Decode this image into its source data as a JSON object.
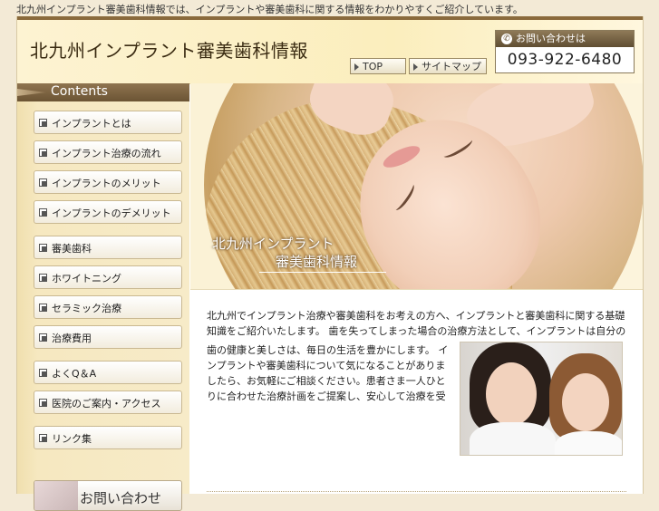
{
  "top_text": "北九州インプラント審美歯科情報では、インプラントや審美歯科に関する情報をわかりやすくご紹介しています。",
  "header": {
    "site_title": "北九州インプラント審美歯科情報",
    "nav": [
      {
        "label": "TOP",
        "icon": "arrow-right-icon"
      },
      {
        "label": "サイトマップ",
        "icon": "arrow-right-icon"
      }
    ],
    "contact_label": "お問い合わせは",
    "phone": "093-922-6480"
  },
  "sidebar": {
    "title": "Contents",
    "items": [
      {
        "label": "インプラントとは"
      },
      {
        "label": "インプラント治療の流れ"
      },
      {
        "label": "インプラントのメリット"
      },
      {
        "label": "インプラントのデメリット"
      },
      {
        "label": "審美歯科"
      },
      {
        "label": "ホワイトニング"
      },
      {
        "label": "セラミック治療"
      },
      {
        "label": "治療費用"
      },
      {
        "label": "よくQ＆A"
      },
      {
        "label": "医院のご案内・アクセス"
      },
      {
        "label": "リンク集"
      }
    ],
    "contact_button": "お問い合わせ"
  },
  "hero": {
    "title_line1": "北九州インプラント",
    "title_line2": "審美歯科情報"
  },
  "main": {
    "paragraph1": "北九州でインプラント治療や審美歯科をお考えの方へ、インプラントと審美歯科に関する基礎知識をご紹介いたします。 歯を失ってしまった場合の治療方法として、インプラントは自分の歯のように噛めることが特徴です。 見た目の美しさを重視した審美歯科治療についても、それぞれの治療法の特徴や費用の目安などをわかりやすくまとめています。",
    "paragraph2": "歯の健康と美しさは、毎日の生活を豊かにします。 インプラントや審美歯科について気になることがありましたら、お気軽にご相談ください。患者さま一人ひとりに合わせた治療計画をご提案し、安心して治療を受けていただけるよう、丁寧なカウンセリングを心がけています。まずはお気軽にお問い合わせください。ご来院を心よりお待ちしております。"
  },
  "colors": {
    "accent_brown": "#6b5434",
    "header_bg": "#fbeebd",
    "sidebar_bg": "#f6e8c0"
  }
}
